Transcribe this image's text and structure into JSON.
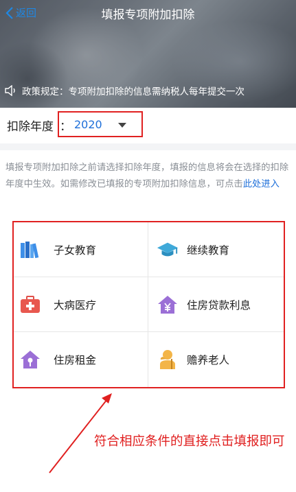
{
  "nav": {
    "back_label": "返回",
    "title": "填报专项附加扣除"
  },
  "notice": {
    "text": "政策规定：专项附加扣除的信息需纳税人每年提交一次"
  },
  "year": {
    "label": "扣除年度",
    "colon": "：",
    "value": "2020"
  },
  "description": {
    "text": "填报专项附加扣除之前请选择扣除年度，填报的信息将会在选择的扣除年度中生效。如需修改已填报的专项附加扣除信息，可点击",
    "link": "此处进入"
  },
  "items": [
    {
      "label": "子女教育",
      "icon": "books-icon"
    },
    {
      "label": "继续教育",
      "icon": "graduation-cap-icon"
    },
    {
      "label": "大病医疗",
      "icon": "medical-kit-icon"
    },
    {
      "label": "住房贷款利息",
      "icon": "house-yen-icon"
    },
    {
      "label": "住房租金",
      "icon": "house-key-icon"
    },
    {
      "label": "赡养老人",
      "icon": "elderly-person-icon"
    }
  ],
  "annotation": {
    "text": "符合相应条件的直接点击填报即可"
  },
  "colors": {
    "accent_blue": "#1e6fd9",
    "highlight_red": "#e02020"
  }
}
